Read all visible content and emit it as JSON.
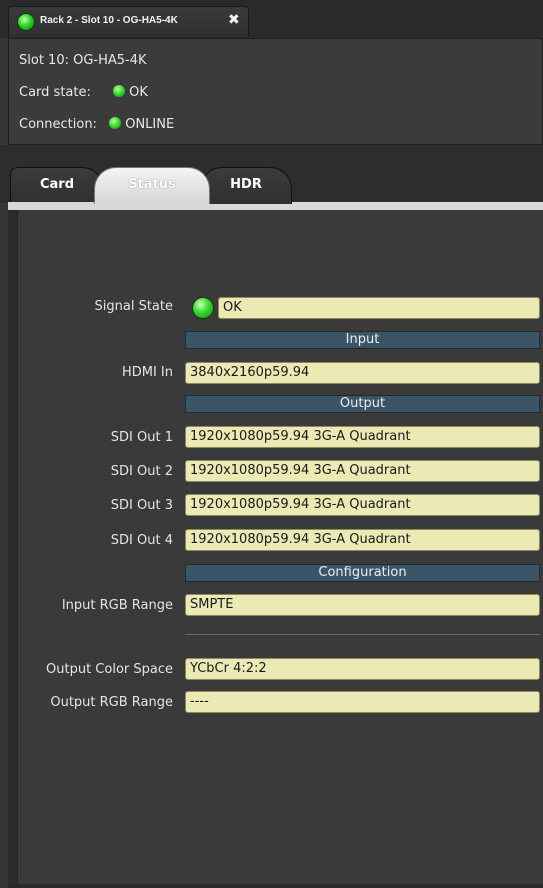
{
  "window": {
    "tab_title": "Rack 2 - Slot 10 - OG-HA5-4K",
    "close_icon": "close-icon"
  },
  "info": {
    "slot": "Slot 10: OG-HA5-4K",
    "card_state_label": "Card state:",
    "card_state_value": "OK",
    "connection_label": "Connection:",
    "connection_value": "ONLINE"
  },
  "tabs": [
    {
      "label": "Card"
    },
    {
      "label": "Status"
    },
    {
      "label": "HDR"
    }
  ],
  "status": {
    "signal_state_label": "Signal State",
    "signal_state_value": "OK",
    "input_section": "Input",
    "hdmi_in_label": "HDMI In",
    "hdmi_in_value": "3840x2160p59.94",
    "output_section": "Output",
    "sdi_out": [
      {
        "label": "SDI Out 1",
        "value": "1920x1080p59.94 3G-A Quadrant"
      },
      {
        "label": "SDI Out 2",
        "value": "1920x1080p59.94 3G-A Quadrant"
      },
      {
        "label": "SDI Out 3",
        "value": "1920x1080p59.94 3G-A Quadrant"
      },
      {
        "label": "SDI Out 4",
        "value": "1920x1080p59.94 3G-A Quadrant"
      }
    ],
    "configuration_section": "Configuration",
    "input_rgb_range_label": "Input RGB Range",
    "input_rgb_range_value": "SMPTE",
    "output_color_space_label": "Output Color Space",
    "output_color_space_value": "YCbCr 4:2:2",
    "output_rgb_range_label": "Output RGB Range",
    "output_rgb_range_value": "----"
  },
  "colors": {
    "led_green": "#2ed82a",
    "field_bg": "#ebe9b4",
    "section_bg": "#3c5566",
    "panel_bg": "#3a3a3a"
  }
}
